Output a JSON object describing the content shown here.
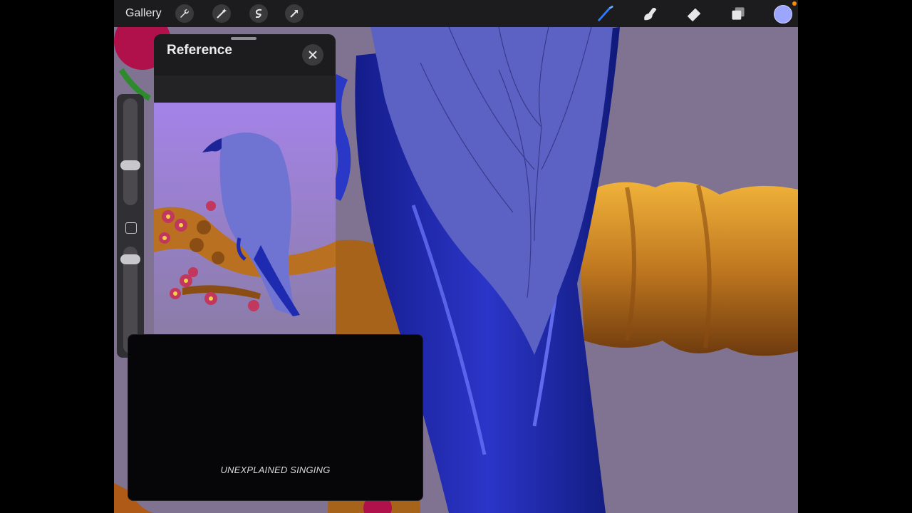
{
  "toolbar": {
    "gallery_label": "Gallery",
    "left_tools": [
      "wrench-icon",
      "magic-wand-icon",
      "selection-icon",
      "transform-arrow-icon"
    ],
    "right_tools": [
      "brush-icon",
      "smudge-icon",
      "eraser-icon",
      "layers-icon"
    ],
    "active_tool": "brush",
    "current_color": "#9da6ff"
  },
  "sidebar": {
    "size_slider_level": 0.35,
    "opacity_slider_level": 0.15
  },
  "reference": {
    "title": "Reference"
  },
  "video_overlay": {
    "caption": "UNEXPLAINED SINGING"
  },
  "colors": {
    "canvas_background": "#7f7391",
    "feathers_dark": "#1e2bb0",
    "feathers_light": "#5c62c4",
    "branch": "#c67a1e"
  }
}
